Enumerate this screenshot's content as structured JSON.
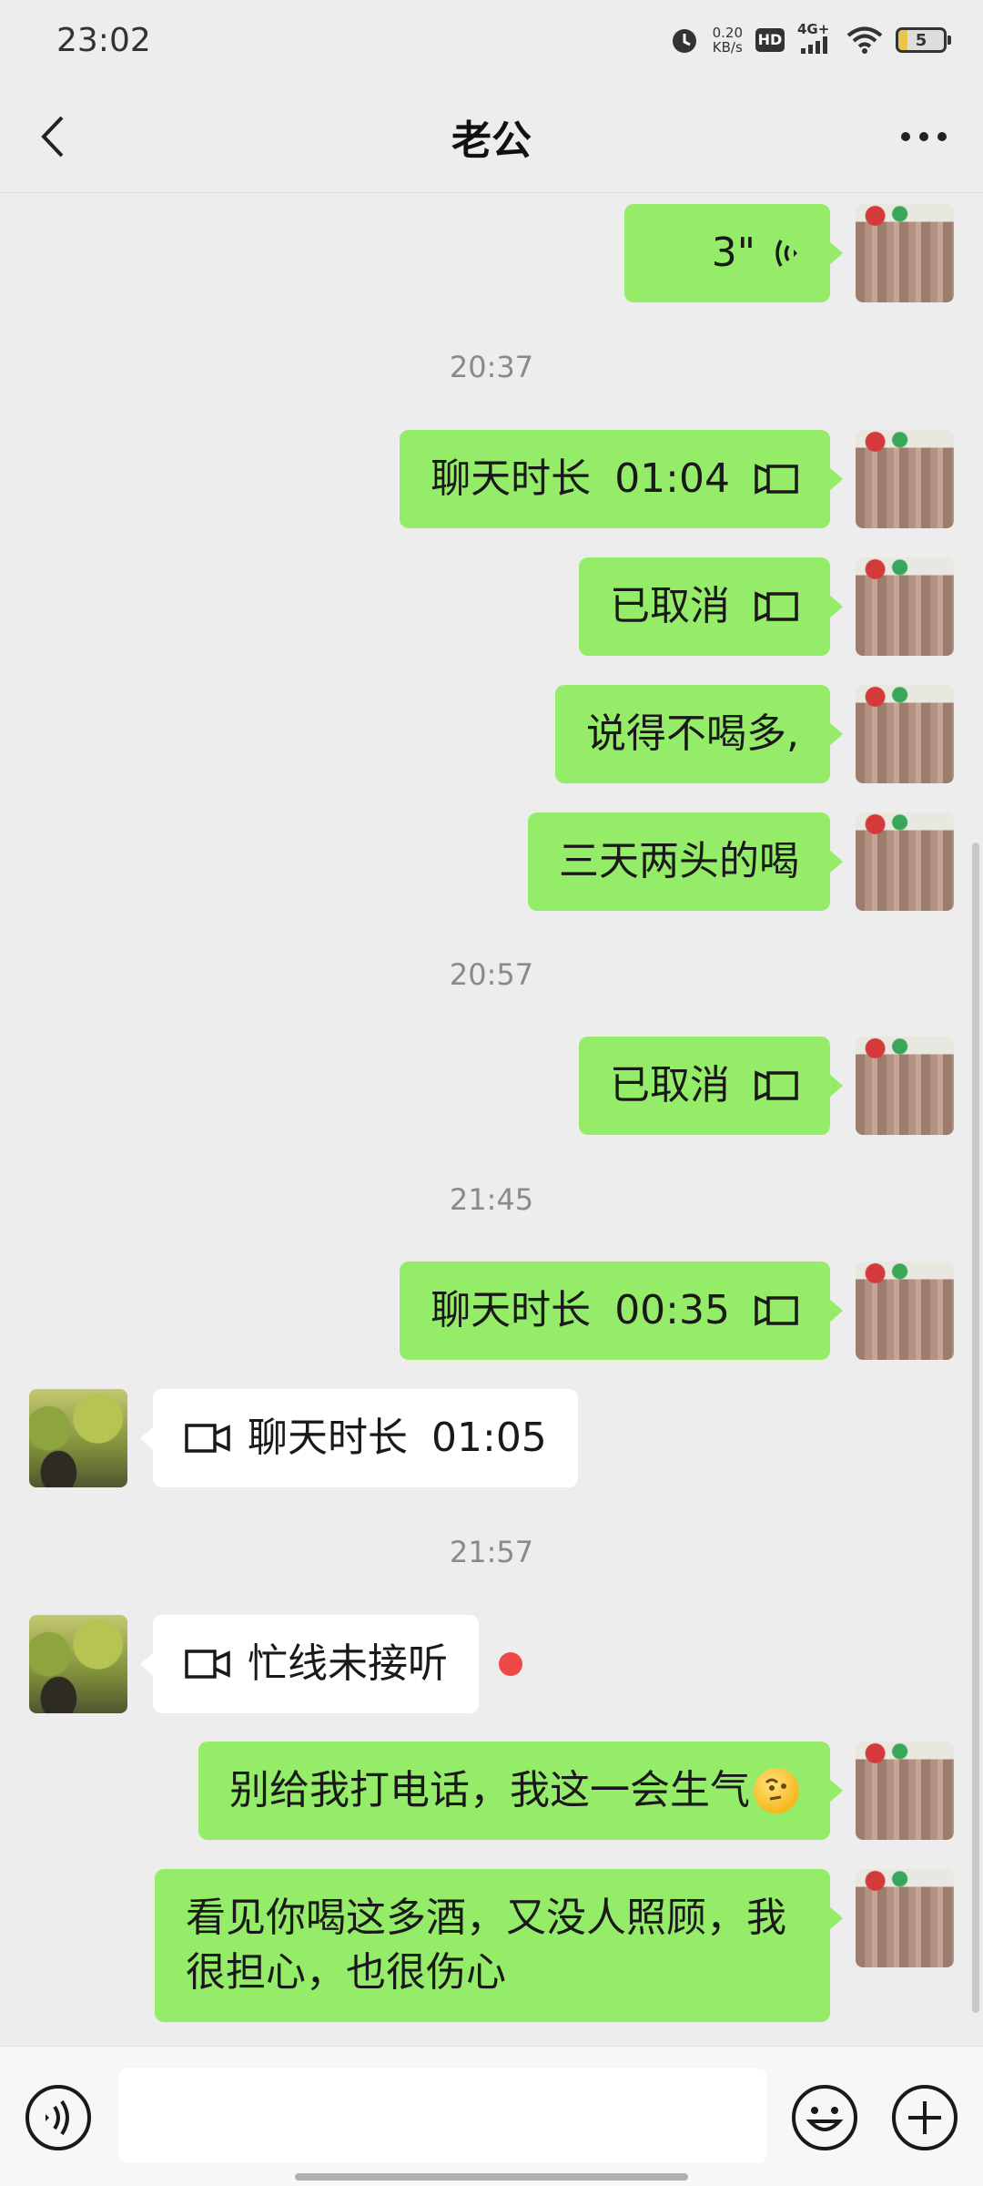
{
  "status_bar": {
    "time": "23:02",
    "net_speed_value": "0.20",
    "net_speed_unit": "KB/s",
    "hd": "HD",
    "network": "4G+",
    "battery": "5",
    "icons": [
      "alarm-icon",
      "hd-icon",
      "signal-icon",
      "wifi-icon",
      "battery-icon"
    ]
  },
  "header": {
    "title": "老公",
    "back_icon": "chevron-left-icon",
    "more_icon": "more-dots-icon"
  },
  "messages": [
    {
      "side": "out",
      "kind": "voice",
      "text": "3\"",
      "icon": "voice-wave-icon"
    },
    {
      "kind": "timestamp",
      "text": "20:37"
    },
    {
      "side": "out",
      "kind": "call",
      "label": "聊天时长",
      "duration": "01:04",
      "icon": "video-call-icon"
    },
    {
      "side": "out",
      "kind": "call",
      "label": "已取消",
      "icon": "video-call-icon"
    },
    {
      "side": "out",
      "kind": "text",
      "text": "说得不喝多,"
    },
    {
      "side": "out",
      "kind": "text",
      "text": "三天两头的喝"
    },
    {
      "kind": "timestamp",
      "text": "20:57"
    },
    {
      "side": "out",
      "kind": "call",
      "label": "已取消",
      "icon": "video-call-icon"
    },
    {
      "kind": "timestamp",
      "text": "21:45"
    },
    {
      "side": "out",
      "kind": "call",
      "label": "聊天时长",
      "duration": "00:35",
      "icon": "video-call-icon"
    },
    {
      "side": "in",
      "kind": "call",
      "label": "聊天时长",
      "duration": "01:05",
      "icon": "video-call-icon"
    },
    {
      "kind": "timestamp",
      "text": "21:57"
    },
    {
      "side": "in",
      "kind": "call",
      "label": "忙线未接听",
      "icon": "video-call-icon",
      "unread": true
    },
    {
      "side": "out",
      "kind": "text",
      "text": "别给我打电话，我这一会生气",
      "emoji": "thinking-face-emoji"
    },
    {
      "side": "out",
      "kind": "text",
      "text": "看见你喝这多酒，又没人照顾，我\n很担心，也很伤心"
    }
  ],
  "input_bar": {
    "placeholder": "",
    "voice_icon": "voice-input-icon",
    "emoji_icon": "emoji-icon",
    "plus_icon": "plus-icon"
  },
  "colors": {
    "background": "#ededed",
    "bubble_out": "#95ec69",
    "bubble_in": "#ffffff",
    "timestamp": "#8a8a8a",
    "unread_dot": "#f04848"
  }
}
